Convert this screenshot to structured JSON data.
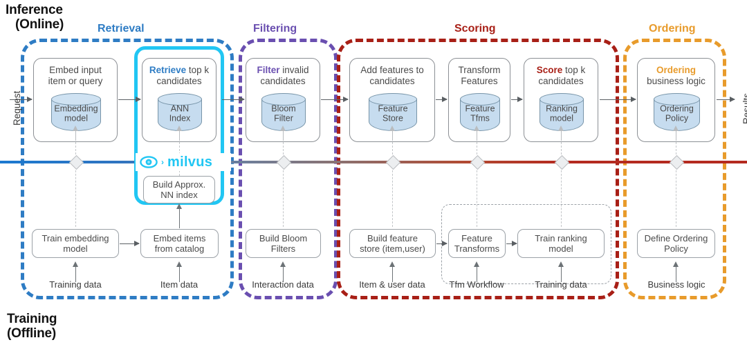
{
  "diagram": {
    "inference_title": "Inference\n(Online)",
    "inference_title_line1": "Inference",
    "inference_title_line2": "(Online)",
    "training_title_line1": "Training",
    "training_title_line2": "(Offline)",
    "request_label": "Request",
    "results_label": "Results",
    "logo_word": "milvus",
    "logo_chevron": "›"
  },
  "colors": {
    "retrieval": "#2e7cc4",
    "filtering": "#6a4fb0",
    "scoring": "#a81f16",
    "ordering": "#e89b2b",
    "milvus_cyan": "#21c6f3",
    "cylinder_fill": "#c6dcef",
    "cylinder_stroke": "#7794a8",
    "card_stroke": "#8b8f94",
    "divider_start": "#1b79d0",
    "divider_end": "#b42a1f"
  },
  "stages": [
    {
      "name": "retrieval",
      "label": "Retrieval",
      "color": "#2e7cc4"
    },
    {
      "name": "filtering",
      "label": "Filtering",
      "color": "#6a4fb0"
    },
    {
      "name": "scoring",
      "label": "Scoring",
      "color": "#a81f16"
    },
    {
      "name": "ordering",
      "label": "Ordering",
      "color": "#e89b2b"
    }
  ],
  "online_steps": [
    {
      "title_bold": "",
      "title_rest": "Embed input",
      "title_line2": "item or query",
      "store_line1": "Embedding",
      "store_line2": "model"
    },
    {
      "title_bold": "Retrieve",
      "title_rest": " top k",
      "title_line2": "candidates",
      "store_line1": "ANN",
      "store_line2": "Index"
    },
    {
      "title_bold": "Filter",
      "title_rest": "  invalid",
      "title_line2": "candidates",
      "store_line1": "Bloom",
      "store_line2": "Filter"
    },
    {
      "title_bold": "",
      "title_rest": "Add features to",
      "title_line2": "candidates",
      "store_line1": "Feature",
      "store_line2": "Store"
    },
    {
      "title_bold": "",
      "title_rest": "Transform",
      "title_line2": "Features",
      "store_line1": "Feature",
      "store_line2": "Tfms"
    },
    {
      "title_bold": "Score",
      "title_rest": " top k",
      "title_line2": "candidates",
      "store_line1": "Ranking",
      "store_line2": "model"
    },
    {
      "title_bold": "Ordering",
      "title_rest": "",
      "title_line2": "business logic",
      "store_line1": "Ordering",
      "store_line2": "Policy"
    }
  ],
  "offline_steps": [
    {
      "line1": "Train embedding",
      "line2": "model"
    },
    {
      "line1": "Embed items",
      "line2": "from catalog"
    },
    {
      "line1": "Build Bloom",
      "line2": "Filters"
    },
    {
      "line1": "Build feature",
      "line2": "store (item,user)"
    },
    {
      "line1": "Feature",
      "line2": "Transforms"
    },
    {
      "line1": "Train ranking",
      "line2": "model"
    },
    {
      "line1": "Define Ordering",
      "line2": "Policy"
    }
  ],
  "milvus_index_box": {
    "line1": "Build Approx.",
    "line2": "NN index"
  },
  "data_sources": [
    {
      "label": "Training data"
    },
    {
      "label": "Item data"
    },
    {
      "label": "Interaction data"
    },
    {
      "label": "Item & user data"
    },
    {
      "label": "Tfm Workflow"
    },
    {
      "label": "Training data"
    },
    {
      "label": "Business logic"
    }
  ]
}
